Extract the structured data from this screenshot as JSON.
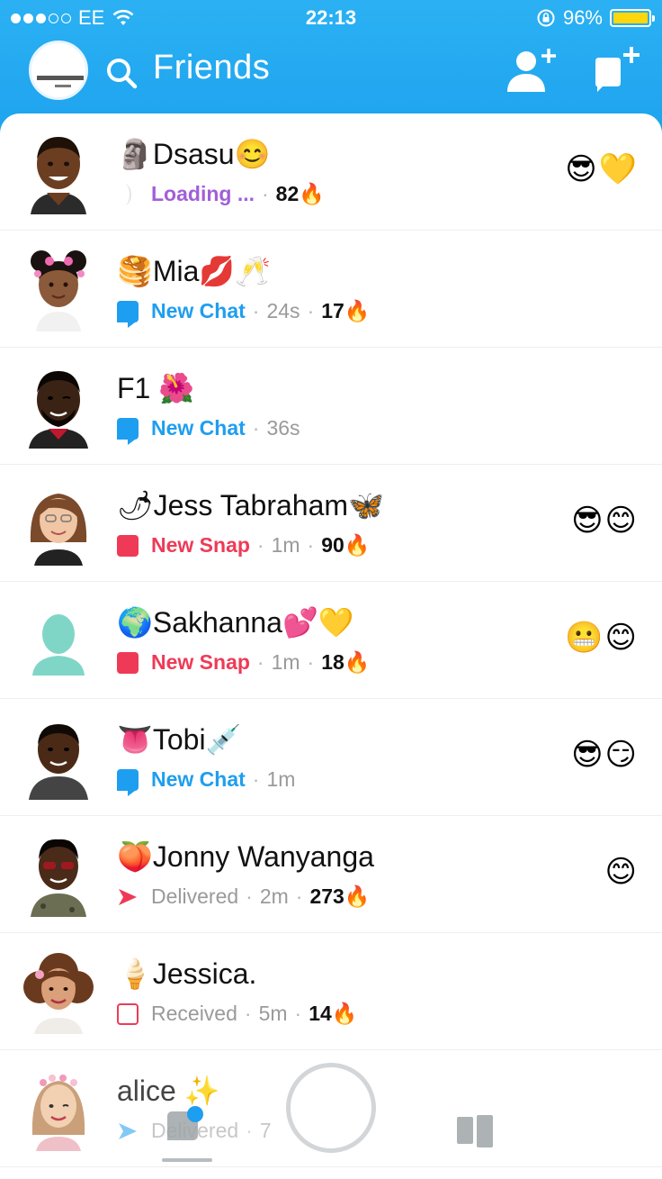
{
  "status_bar": {
    "carrier": "EE",
    "time": "22:13",
    "battery": "96%"
  },
  "header": {
    "title": "Friends"
  },
  "colors": {
    "header_blue": "#1ea3ee",
    "chat_blue": "#1e9ef0",
    "snap_red": "#ef3a57",
    "loading_purple": "#a15fd8",
    "streak_fire": "🔥"
  },
  "friends": [
    {
      "name": "🗿Dsasu😊",
      "status_icon": "loading-icon",
      "status": "Loading ...",
      "status_color": "#a15fd8",
      "time": "",
      "streak": "82🔥",
      "right_emojis": "😎💛"
    },
    {
      "name": "🥞Mia💋🥂",
      "status_icon": "chat-icon",
      "status": "New Chat",
      "status_color": "#1e9ef0",
      "time": "24s",
      "streak": "17🔥",
      "right_emojis": ""
    },
    {
      "name": "F1 🌺",
      "status_icon": "chat-icon",
      "status": "New Chat",
      "status_color": "#1e9ef0",
      "time": "36s",
      "streak": "",
      "right_emojis": ""
    },
    {
      "name": "🌶Jess Tabraham🦋",
      "status_icon": "snap-icon",
      "status": "New Snap",
      "status_color": "#ef3a57",
      "time": "1m",
      "streak": "90🔥",
      "right_emojis": "😎😊"
    },
    {
      "name": "🌍Sakhanna💕💛",
      "status_icon": "snap-icon",
      "status": "New Snap",
      "status_color": "#ef3a57",
      "time": "1m",
      "streak": "18🔥",
      "right_emojis": "😬😊"
    },
    {
      "name": "👅Tobi💉",
      "status_icon": "chat-icon",
      "status": "New Chat",
      "status_color": "#1e9ef0",
      "time": "1m",
      "streak": "",
      "right_emojis": "😎😏"
    },
    {
      "name": "🍑Jonny Wanyanga",
      "status_icon": "delivered-icon",
      "status": "Delivered",
      "status_color": "#9a9a9a",
      "time": "2m",
      "streak": "273🔥",
      "right_emojis": "😊"
    },
    {
      "name": "🍦Jessica.",
      "status_icon": "received-icon",
      "status": "Received",
      "status_color": "#9a9a9a",
      "time": "5m",
      "streak": "14🔥",
      "right_emojis": ""
    },
    {
      "name": "alice ✨",
      "status_icon": "delivered-icon",
      "status": "Delivered",
      "status_color": "#9a9a9a",
      "time": "7",
      "streak": "",
      "right_emojis": ""
    }
  ]
}
